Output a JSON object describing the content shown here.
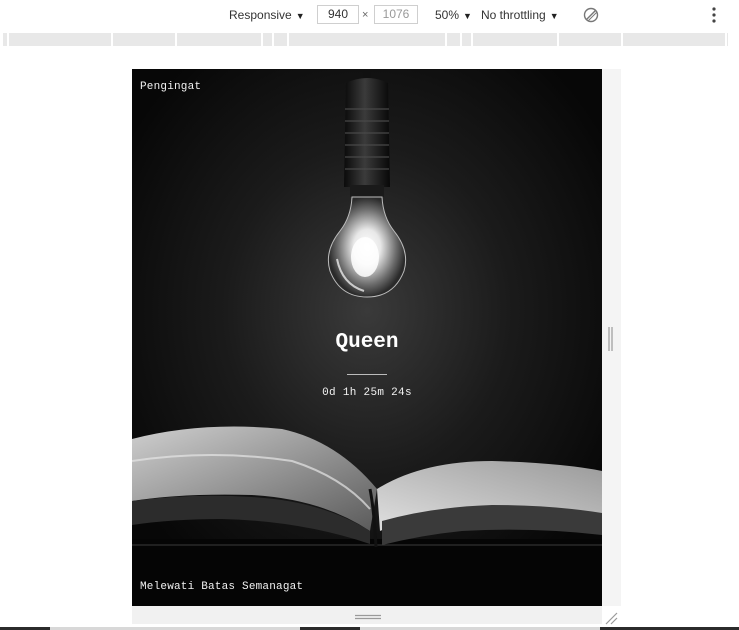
{
  "devtools": {
    "device_mode": "Responsive",
    "width_value": "940",
    "height_value": "1076",
    "times_symbol": "×",
    "zoom": "50%",
    "throttling": "No throttling",
    "rotate_icon": "rotate-disabled-icon",
    "more_icon": "vertical-dots-icon"
  },
  "page": {
    "header_label": "Pengingat",
    "name": "Queen",
    "countdown": "0d 1h 25m 24s",
    "footer_text": "Melewati Batas Semanagat",
    "background_image": "lightbulb-and-open-book-photo"
  },
  "colors": {
    "page_background": "#0c0c0c",
    "text": "#ffffff",
    "toolbar_background": "#ffffff",
    "ruler_segment": "#e8e8e8"
  }
}
